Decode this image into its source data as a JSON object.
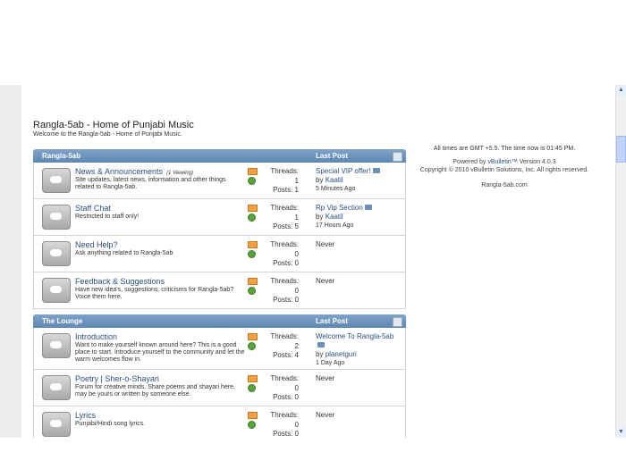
{
  "header": {
    "title": "Rangla-5ab - Home of Punjabi Music",
    "subtitle": "Welcome to the Rangla-5ab - Home of Punjabi Music."
  },
  "categories": [
    {
      "name": "Rangla-5ab",
      "last_post_label": "Last Post",
      "forums": [
        {
          "name": "News & Announcements",
          "viewing": "(1 Viewing)",
          "desc": "Site updates, latest news, information and other things related to Rangla-5ab.",
          "threads_label": "Threads:",
          "threads": "1",
          "posts_label": "Posts:",
          "posts": "1",
          "lp_title": "Special VIP offer!",
          "lp_by": "by",
          "lp_user": "Kaatil",
          "lp_time": "5 Minutes Ago"
        },
        {
          "name": "Staff Chat",
          "viewing": "",
          "desc": "Restricted to staff only!",
          "threads_label": "Threads:",
          "threads": "1",
          "posts_label": "Posts:",
          "posts": "5",
          "lp_title": "Rp Vip Section",
          "lp_by": "by",
          "lp_user": "Kaatil",
          "lp_time": "17 Hours Ago"
        },
        {
          "name": "Need Help?",
          "viewing": "",
          "desc": "Ask anything related to Rangla-5ab",
          "threads_label": "Threads:",
          "threads": "0",
          "posts_label": "Posts:",
          "posts": "0",
          "lp_never": "Never"
        },
        {
          "name": "Feedback & Suggestions",
          "viewing": "",
          "desc": "Have new idea's, suggestions, criticisms for Rangla-5ab? Voice them here.",
          "threads_label": "Threads:",
          "threads": "0",
          "posts_label": "Posts:",
          "posts": "0",
          "lp_never": "Never"
        }
      ]
    },
    {
      "name": "The Lounge",
      "last_post_label": "Last Post",
      "forums": [
        {
          "name": "Introduction",
          "viewing": "",
          "desc": "Want to make yourself known around here? This is a good place to start. Introduce yourself to the community and let the warm welcomes flow in.",
          "threads_label": "Threads:",
          "threads": "2",
          "posts_label": "Posts:",
          "posts": "4",
          "lp_title": "Welcome To Rangla-5ab",
          "lp_by": "by",
          "lp_user": "planetguri",
          "lp_time": "1 Day Ago"
        },
        {
          "name": "Poetry | Sher-o-Shayari",
          "viewing": "",
          "desc": "Forum for creative minds. Share poems and shayari here, may be yours or written by someone else.",
          "threads_label": "Threads:",
          "threads": "0",
          "posts_label": "Posts:",
          "posts": "0",
          "lp_never": "Never"
        },
        {
          "name": "Lyrics",
          "viewing": "",
          "desc": "Punjabi/Hindi song lyrics.",
          "threads_label": "Threads:",
          "threads": "0",
          "posts_label": "Posts:",
          "posts": "0",
          "lp_never": "Never"
        }
      ]
    }
  ],
  "sidebar": {
    "time_prefix": "All times are GMT +5.5. The time now is",
    "time_value": "01:45 PM",
    "powered_prefix": "Powered by",
    "powered_link": "vBulletin™",
    "version": "Version 4.0.3",
    "copyright": "Copyright © 2010 vBulletin Solutions, Inc. All rights reserved.",
    "site": "Rangla-5ab.com"
  },
  "scrollbar": {
    "up": "▲",
    "down": "▼"
  }
}
